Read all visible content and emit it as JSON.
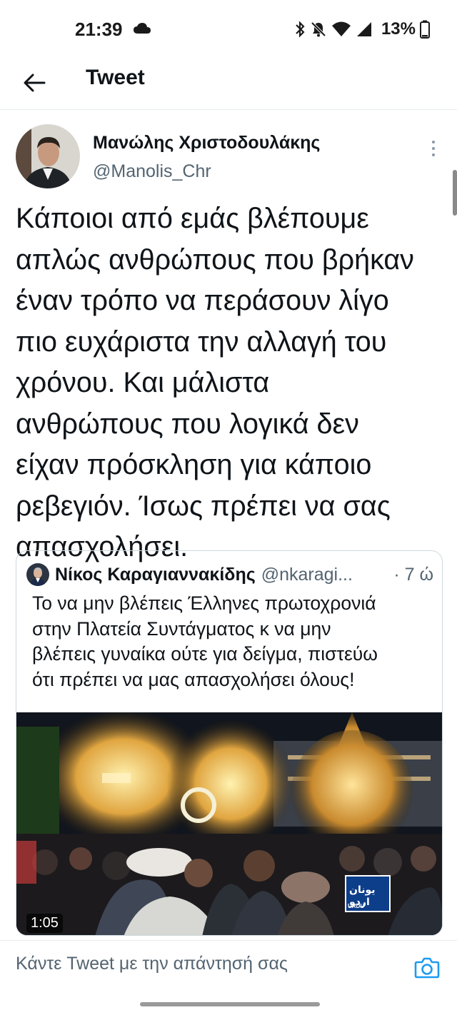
{
  "status_bar": {
    "time": "21:39",
    "battery": "13%"
  },
  "header": {
    "title": "Tweet"
  },
  "tweet": {
    "author_name": "Μανώλης Χριστοδουλάκης",
    "author_handle": "@Manolis_Chr",
    "text": "Κάποιοι από εμάς βλέπουμε\nαπλώς ανθρώπους που βρήκαν\nέναν τρόπο να περάσουν λίγο\nπιο ευχάριστα την αλλαγή του\nχρόνου. Και μάλιστα\nανθρώπους που λογικά δεν\nείχαν πρόσκληση για κάποιο\nρεβεγιόν. Ίσως πρέπει να σας\nαπασχολήσει."
  },
  "quoted_tweet": {
    "author_name": "Νίκος Καραγιαννακίδης",
    "author_handle": "@nkaragi...",
    "time": "· 7 ώ",
    "text": "Το να μην βλέπεις Έλληνες πρωτοχρονιά\nστην Πλατεία Συντάγματος κ να μην\nβλέπεις γυναίκα ούτε για δείγμα, πιστεύω\nότι πρέπει να μας απασχολήσει όλους!",
    "video_duration": "1:05",
    "video_logo": "یونان اردو",
    "video_logo_sub": "URDU"
  },
  "reply_bar": {
    "placeholder": "Κάντε Tweet με την απάντησή σας"
  },
  "icons": {
    "back": "arrow-left-icon",
    "more": "more-vertical-icon",
    "camera": "camera-icon",
    "cloud": "cloud-icon",
    "bluetooth": "bluetooth-icon",
    "mute": "bell-off-icon",
    "wifi": "wifi-icon",
    "signal": "signal-icon",
    "battery": "battery-icon"
  },
  "colors": {
    "text_primary": "#0f1419",
    "text_secondary": "#536471",
    "accent_blue": "#1d9bf0",
    "divider": "#e6ecf0"
  }
}
